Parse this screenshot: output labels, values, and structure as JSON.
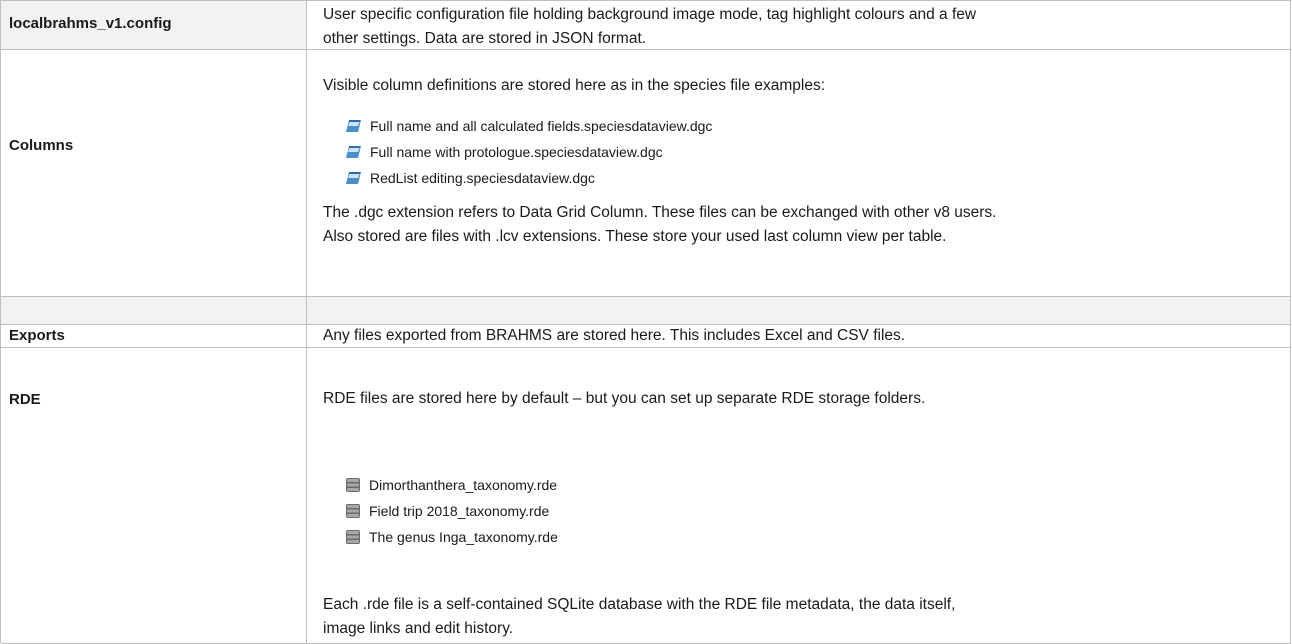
{
  "rows": [
    {
      "key": "localbrahms_v1.config",
      "lines": [
        "User specific configuration file holding background image mode, tag highlight colours and a few",
        "other settings. Data are stored in JSON format."
      ]
    },
    {
      "key": "Columns",
      "intro": "Visible column definitions are stored here as in the species file examples:",
      "files": [
        {
          "name": "Full name and all calculated fields.speciesdataview.dgc",
          "icon": "dgc-file-icon"
        },
        {
          "name": "Full name with protologue.speciesdataview.dgc",
          "icon": "dgc-file-icon"
        },
        {
          "name": "RedList editing.speciesdataview.dgc",
          "icon": "dgc-file-icon"
        }
      ],
      "outro": [
        "The .dgc extension refers to Data Grid Column. These files can be exchanged with other v8 users.",
        "Also stored are files with .lcv extensions. These store your used last column view per table."
      ]
    },
    {
      "key": "Exports",
      "lines": [
        "Any files exported from BRAHMS are stored here. This includes Excel and CSV files."
      ]
    },
    {
      "key": "RDE",
      "intro": "RDE files are stored here by default – but you can set up separate RDE storage folders.",
      "files": [
        {
          "name": "Dimorthanthera_taxonomy.rde",
          "icon": "database-icon"
        },
        {
          "name": "Field trip 2018_taxonomy.rde",
          "icon": "database-icon"
        },
        {
          "name": "The genus Inga_taxonomy.rde",
          "icon": "database-icon"
        }
      ],
      "outro": [
        "Each .rde file is a self-contained SQLite database with the RDE file metadata, the data itself,",
        "image links and edit history."
      ]
    }
  ],
  "colors": {
    "border": "#bfbfbf",
    "header_fill": "#f2f2f2"
  }
}
